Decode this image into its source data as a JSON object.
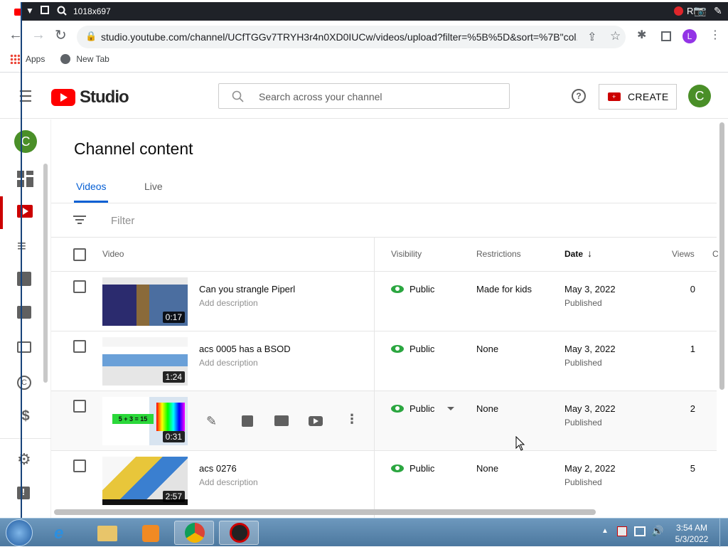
{
  "recorder": {
    "dimensions": "1018x697",
    "rec_label": "REC"
  },
  "browser": {
    "url": "studio.youtube.com/channel/UCfTGGv7TRYH3r4n0XD0IUCw/videos/upload?filter=%5B%5D&sort=%7B\"col...",
    "profile_initial": "L",
    "bookmarks": [
      {
        "label": "Apps"
      },
      {
        "label": "New Tab"
      }
    ]
  },
  "studio": {
    "logo_text": "Studio",
    "search_placeholder": "Search across your channel",
    "create_label": "CREATE",
    "avatar_initial": "C"
  },
  "sidebar": {
    "avatar_initial": "C"
  },
  "main": {
    "title": "Channel content",
    "tabs": [
      {
        "label": "Videos"
      },
      {
        "label": "Live"
      }
    ],
    "filter_placeholder": "Filter",
    "columns": {
      "video": "Video",
      "visibility": "Visibility",
      "restrictions": "Restrictions",
      "date": "Date",
      "views": "Views",
      "extra": "C"
    },
    "rows": [
      {
        "title": "Can you strangle Piperl",
        "description": "Add description",
        "duration": "0:17",
        "visibility": "Public",
        "restrictions": "Made for kids",
        "date": "May 3, 2022",
        "status": "Published",
        "views": "0"
      },
      {
        "title": "acs 0005 has a BSOD",
        "description": "Add description",
        "duration": "1:24",
        "visibility": "Public",
        "restrictions": "None",
        "date": "May 3, 2022",
        "status": "Published",
        "views": "1"
      },
      {
        "title": "",
        "description": "",
        "duration": "0:31",
        "visibility": "Public",
        "restrictions": "None",
        "date": "May 3, 2022",
        "status": "Published",
        "views": "2"
      },
      {
        "title": "acs 0276",
        "description": "Add description",
        "duration": "2:57",
        "visibility": "Public",
        "restrictions": "None",
        "date": "May 2, 2022",
        "status": "Published",
        "views": "5"
      }
    ],
    "hover_thumb_text": "5 + 3 = 15"
  },
  "taskbar": {
    "time": "3:54 AM",
    "date": "5/3/2022"
  },
  "colors": {
    "accent": "#065fd4",
    "brand_red": "#ff0000",
    "public_green": "#2ba640",
    "avatar_green": "#4a8f28"
  }
}
